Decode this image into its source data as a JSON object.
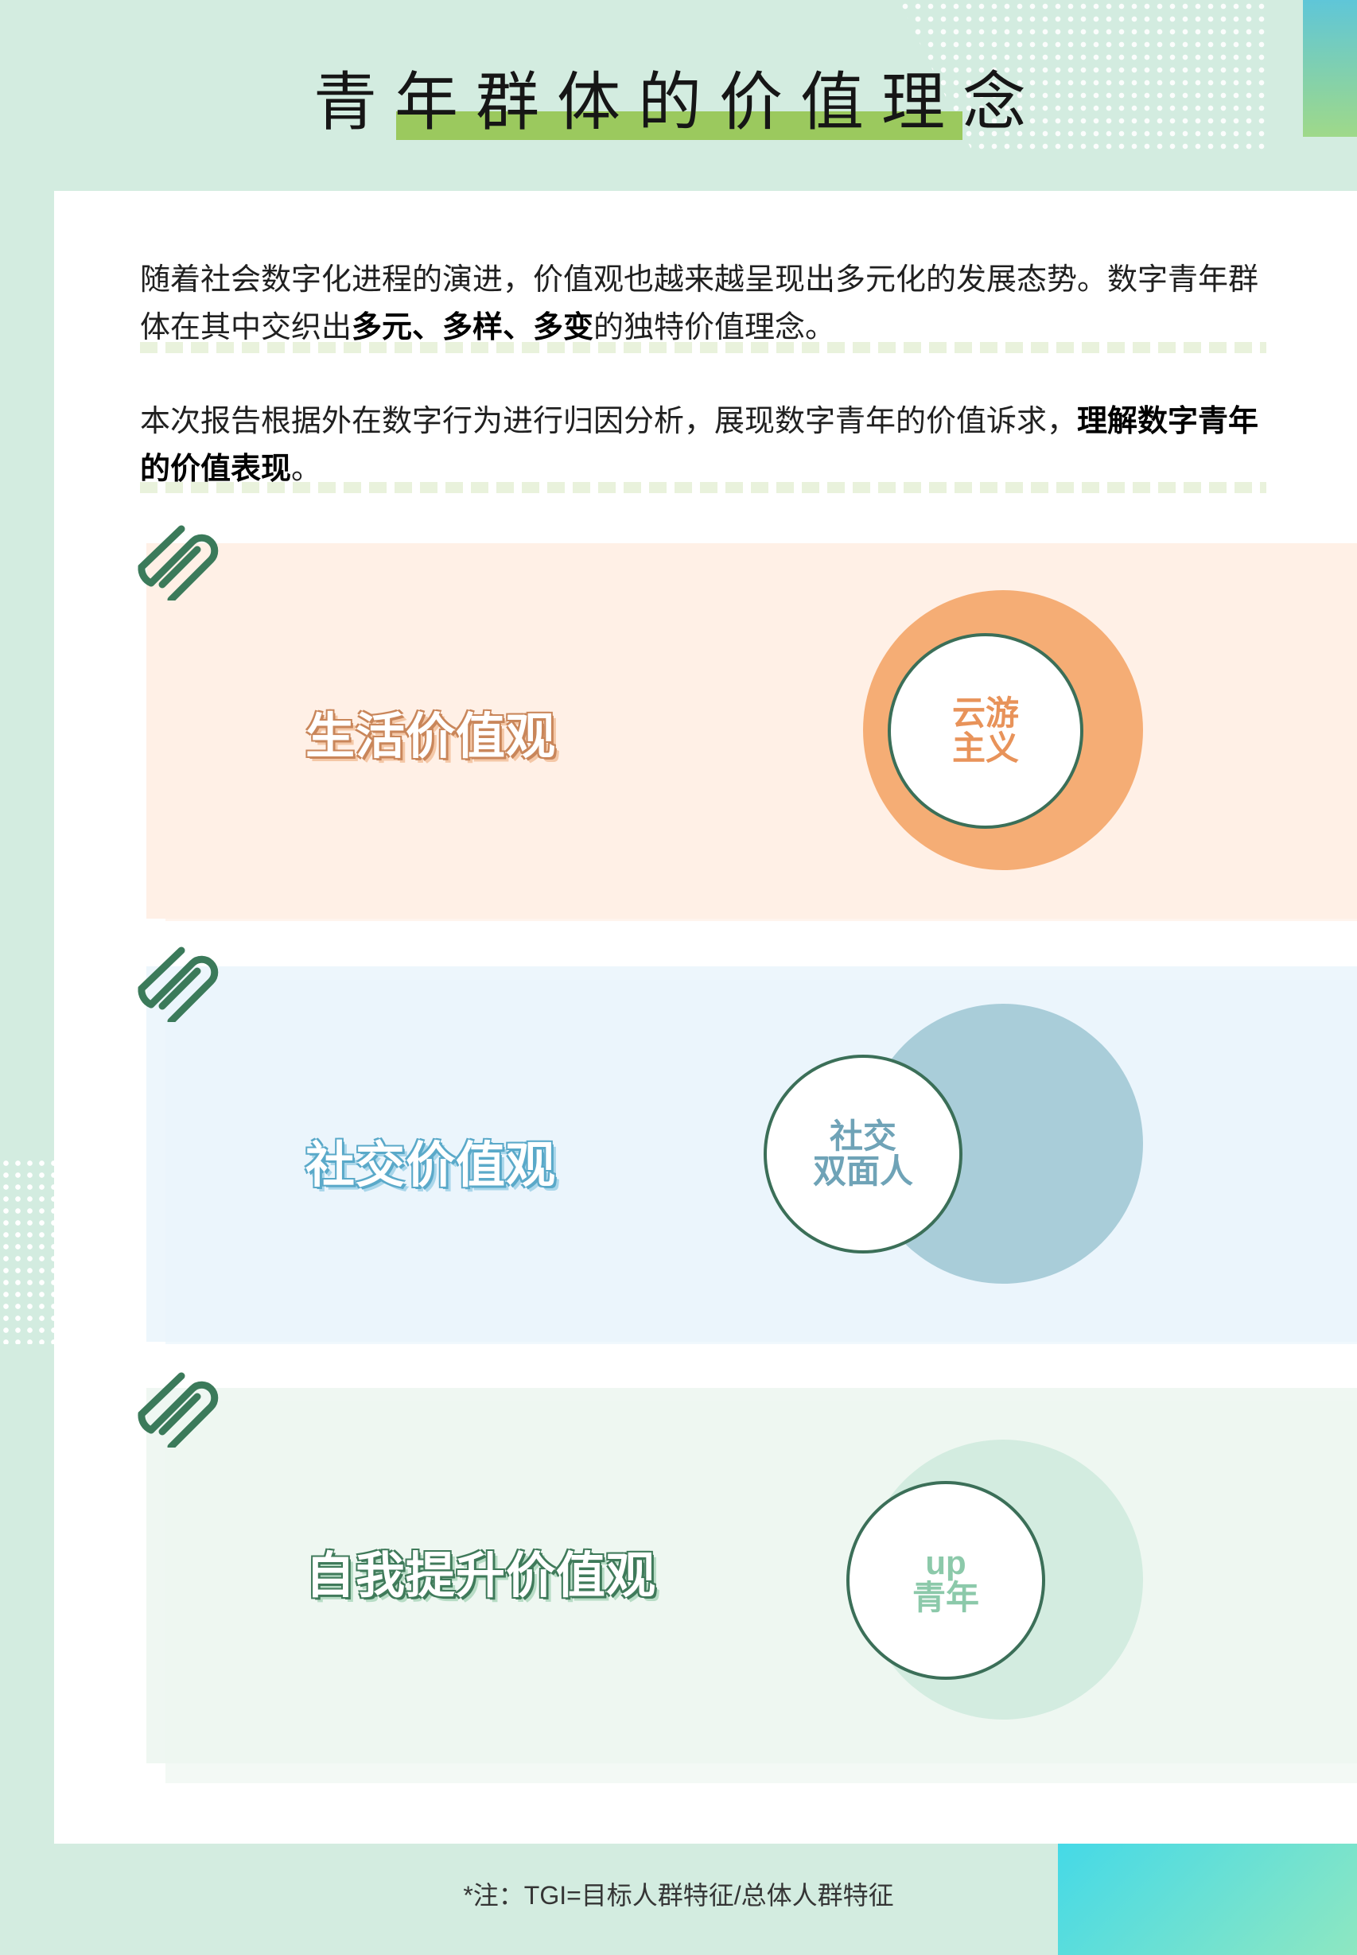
{
  "page": {
    "title": "青年群体的价值理念",
    "intro": {
      "p1_a": "随着社会数字化进程的演进，价值观也越来越呈现出多元化的发展态势。数字青年群体在其中交织出",
      "p1_b": "多元、多样、多变",
      "p1_c": "的独特价值理念。",
      "p2_a": "本次报告根据外在数字行为进行归因分析，展现数字青年的价值诉求，",
      "p2_b": "理解数字青年的价值表现",
      "p2_c": "。"
    },
    "sections": [
      {
        "heading": "生活价值观",
        "circle_line1": "云游",
        "circle_line2": "主义",
        "accent": "#f5ad75"
      },
      {
        "heading": "社交价值观",
        "circle_line1": "社交",
        "circle_line2": "双面人",
        "accent": "#a9cdd9"
      },
      {
        "heading": "自我提升价值观",
        "circle_line1": "up",
        "circle_line2": "青年",
        "accent": "#d3ece0"
      }
    ],
    "footnote": "*注：TGI=目标人群特征/总体人群特征",
    "icons": {
      "section_marker": "paperclip-icon"
    },
    "colors": {
      "title_highlight": "#9bc95e",
      "clip": "#3b7a5a",
      "background": "#d3ece0"
    }
  }
}
